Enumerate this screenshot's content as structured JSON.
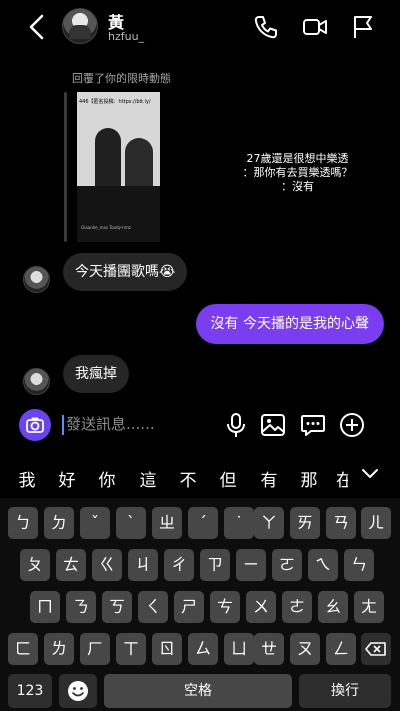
{
  "header": {
    "name": "黃",
    "username": "hzfuu_",
    "icons": [
      "back-arrow-icon",
      "phone-icon",
      "video-icon",
      "flag-icon"
    ]
  },
  "story_reply": {
    "label": "回覆了你的限時動態",
    "thumbnail_top_text": "446【匿名投稿：https://bit.ly/",
    "thumbnail_bottom_text": "Giaanhe_mas Toady-hmz",
    "overlay_lines": [
      "27歲還是很想中樂透",
      "：那你有去買樂透嗎？",
      "：沒有"
    ]
  },
  "messages": [
    {
      "direction": "in",
      "text": "今天播團歌嗎😭"
    },
    {
      "direction": "out",
      "text": "沒有 今天播的是我的心聲"
    },
    {
      "direction": "in",
      "text": "我瘋掉"
    }
  ],
  "compose": {
    "placeholder": "發送訊息......",
    "icons": [
      "camera-icon",
      "microphone-icon",
      "image-icon",
      "sticker-icon",
      "add-icon"
    ],
    "accent_color": "#6a45ee"
  },
  "suggestions": [
    "我",
    "好",
    "你",
    "這",
    "不",
    "但",
    "有",
    "那",
    "在"
  ],
  "keyboard": {
    "row1": [
      "ㄅ",
      "ㄉ",
      "ˇ",
      "ˋ",
      "ㄓ",
      "ˊ",
      "˙",
      "ㄚ",
      "ㄞ",
      "ㄢ",
      "ㄦ"
    ],
    "row2": [
      "ㄆ",
      "ㄊ",
      "ㄍ",
      "ㄐ",
      "ㄔ",
      "ㄗ",
      "ㄧ",
      "ㄛ",
      "ㄟ",
      "ㄣ"
    ],
    "row3": [
      "ㄇ",
      "ㄋ",
      "ㄎ",
      "ㄑ",
      "ㄕ",
      "ㄘ",
      "ㄨ",
      "ㄜ",
      "ㄠ",
      "ㄤ"
    ],
    "row4": [
      "ㄈ",
      "ㄌ",
      "ㄏ",
      "ㄒ",
      "ㄖ",
      "ㄙ",
      "ㄩ",
      "ㄝ",
      "ㄡ",
      "ㄥ"
    ],
    "numbers_key": "123",
    "space_key": "空格",
    "return_key": "換行",
    "delete_icon": "backspace-icon",
    "emoji_icon": "emoji-icon"
  },
  "colors": {
    "background": "#000000",
    "outgoing_bubble": "#7a3df0",
    "incoming_bubble": "#262626",
    "key": "#474747"
  }
}
